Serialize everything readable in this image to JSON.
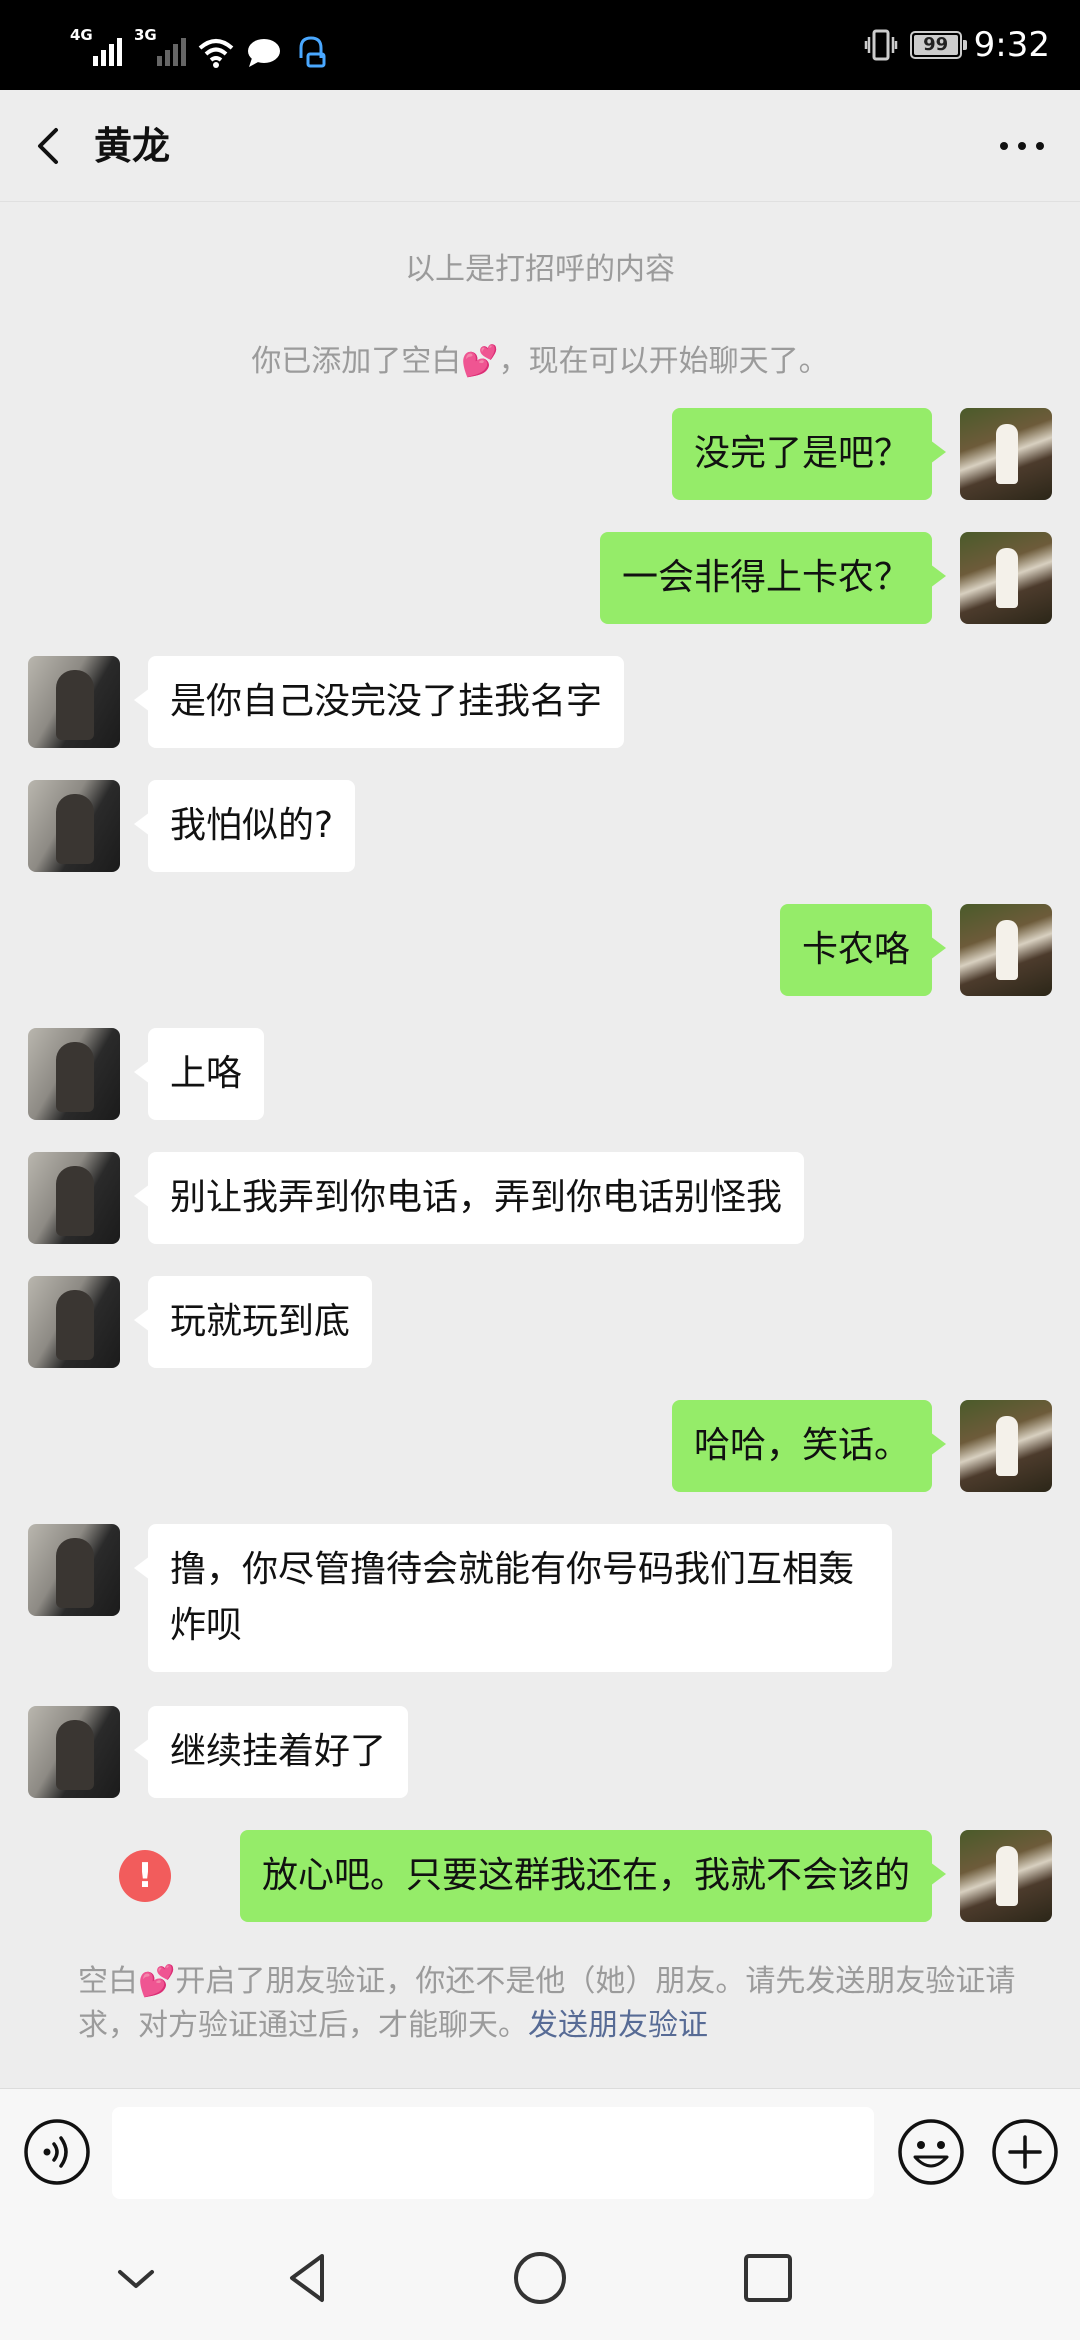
{
  "status_bar": {
    "network_1": "4G",
    "network_2": "3G",
    "battery": "99",
    "time": "9:32",
    "icons": [
      "signal-icon",
      "wifi-icon",
      "message-icon",
      "notification-icon",
      "vibrate-icon",
      "battery-icon"
    ]
  },
  "header": {
    "title": "黄龙",
    "back_icon": "chevron-left-icon",
    "more_icon": "more-icon"
  },
  "system_messages": {
    "greeting_notice": "以上是打招呼的内容",
    "added_notice": "你已添加了空白💕，现在可以开始聊天了。"
  },
  "messages": [
    {
      "side": "out",
      "text": "没完了是吧？"
    },
    {
      "side": "out",
      "text": "一会非得上卡农？"
    },
    {
      "side": "in",
      "text": "是你自己没完没了挂我名字"
    },
    {
      "side": "in",
      "text": "我怕似的?"
    },
    {
      "side": "out",
      "text": "卡农咯"
    },
    {
      "side": "in",
      "text": "上咯"
    },
    {
      "side": "in",
      "text": "别让我弄到你电话，弄到你电话别怪我"
    },
    {
      "side": "in",
      "text": "玩就玩到底"
    },
    {
      "side": "out",
      "text": "哈哈，笑话。"
    },
    {
      "side": "in",
      "text": "撸，你尽管撸待会就能有你号码我们互相轰炸呗"
    },
    {
      "side": "in",
      "text": "继续挂着好了"
    },
    {
      "side": "out",
      "text": "放心吧。只要这群我还在，我就不会该的",
      "failed": true
    }
  ],
  "failed_marker": "!",
  "verification_notice": {
    "text": "空白💕开启了朋友验证，你还不是他（她）朋友。请先发送朋友验证请求，对方验证通过后，才能聊天。",
    "link": "发送朋友验证"
  },
  "input_bar": {
    "voice_icon": "voice-icon",
    "emoji_icon": "emoji-icon",
    "plus_icon": "plus-icon",
    "value": ""
  },
  "system_nav": {
    "icons": [
      "chevron-down-icon",
      "back-triangle-icon",
      "home-circle-icon",
      "recent-square-icon"
    ]
  },
  "colors": {
    "background": "#ededed",
    "outgoing_bubble": "#95ec69",
    "incoming_bubble": "#ffffff",
    "link": "#576b95",
    "error": "#f25c5c"
  }
}
